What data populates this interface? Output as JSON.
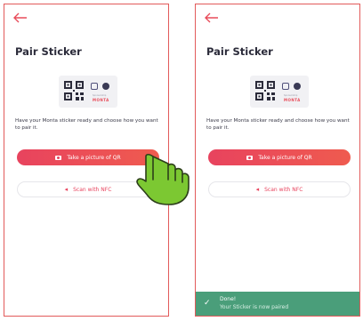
{
  "screen_left": {
    "title": "Pair Sticker",
    "sticker_brand": "MONTA",
    "sticker_subtext": "Sponsorship",
    "description": "Have your Monta sticker ready and choose how you want to pair it.",
    "primary_button": "Take a picture of QR",
    "secondary_button": "Scan with NFC"
  },
  "screen_right": {
    "title": "Pair Sticker",
    "sticker_brand": "MONTA",
    "sticker_subtext": "Sponsorship",
    "description": "Have your Monta sticker ready and choose how you want to pair it.",
    "primary_button": "Take a picture of QR",
    "secondary_button": "Scan with NFC",
    "toast": {
      "title": "Done!",
      "message": "Your Sticker is now paired"
    }
  },
  "icons": {
    "back": "arrow-left-icon",
    "camera": "camera-icon",
    "nfc": "nfc-icon",
    "qr": "qr-code-icon",
    "check": "check-icon",
    "hand": "pointing-hand-icon"
  },
  "colors": {
    "accent": "#e8435e",
    "frame": "#e25a5a",
    "toast": "#4a9e7a",
    "hand": "#7cc832"
  }
}
